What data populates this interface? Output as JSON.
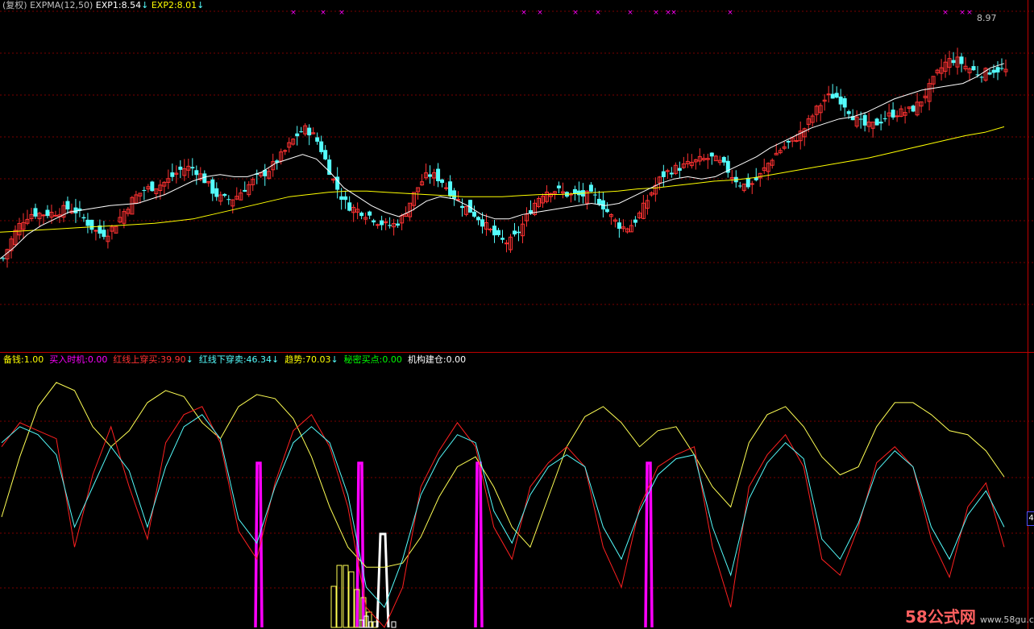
{
  "colors": {
    "up": "#ff3232",
    "down": "#54fcfc",
    "exp1": "#ffffff",
    "exp2": "#ffff00",
    "grid": "#7a0000",
    "cyan": "#54fcfc",
    "yellow": "#ffff54",
    "red": "#ff2020",
    "magenta": "#ff00ff",
    "white": "#ffffff",
    "green": "#00ff00"
  },
  "top_header": [
    {
      "text": "(复权) EXPMA(12,50)",
      "color": "#c0c0c0"
    },
    {
      "text": "EXP1:8.54",
      "color": "#ffffff"
    },
    {
      "text": "↓",
      "color": "#54fcfc"
    },
    {
      "text": "EXP2:8.01",
      "color": "#ffff00"
    },
    {
      "text": "↓",
      "color": "#54fcfc"
    }
  ],
  "high_label": "8.97",
  "bottom_header": [
    {
      "text": "备钱:1.00",
      "color": "#ffff00"
    },
    {
      "text": "买入时机:0.00",
      "color": "#ff00ff"
    },
    {
      "text": "红线上穿买:39.90",
      "color": "#ff3232"
    },
    {
      "text": "↓",
      "color": "#54fcfc"
    },
    {
      "text": "红线下穿卖:46.34",
      "color": "#54fcfc"
    },
    {
      "text": "↓",
      "color": "#54fcfc"
    },
    {
      "text": "趋势:70.03",
      "color": "#ffff00"
    },
    {
      "text": "↓",
      "color": "#54fcfc"
    },
    {
      "text": "秘密买点:0.00",
      "color": "#00ff00"
    },
    {
      "text": "机构建仓:0.00",
      "color": "#ffffff"
    }
  ],
  "right_marker": "4",
  "watermark": {
    "brand": "58公式网",
    "url": "www.58gu.com"
  },
  "chart_data": [
    {
      "type": "candlestick",
      "title": "",
      "series": [
        {
          "name": "EXP1",
          "color": "#ffffff",
          "values": [
            6.82,
            6.92,
            7.04,
            7.12,
            7.18,
            7.24,
            7.26,
            7.28,
            7.3,
            7.31,
            7.32,
            7.36,
            7.4,
            7.46,
            7.52,
            7.56,
            7.58,
            7.56,
            7.56,
            7.6,
            7.68,
            7.72,
            7.76,
            7.72,
            7.6,
            7.46,
            7.38,
            7.3,
            7.24,
            7.2,
            7.26,
            7.34,
            7.38,
            7.36,
            7.3,
            7.22,
            7.18,
            7.18,
            7.22,
            7.24,
            7.26,
            7.28,
            7.3,
            7.32,
            7.3,
            7.32,
            7.38,
            7.44,
            7.5,
            7.54,
            7.56,
            7.54,
            7.56,
            7.62,
            7.68,
            7.74,
            7.82,
            7.88,
            7.94,
            8.0,
            8.04,
            8.08,
            8.1,
            8.14,
            8.2,
            8.26,
            8.3,
            8.34,
            8.36,
            8.38,
            8.4,
            8.46,
            8.54,
            8.58
          ]
        },
        {
          "name": "EXP2",
          "color": "#ffff00",
          "values": [
            7.06,
            7.07,
            7.08,
            7.09,
            7.1,
            7.11,
            7.12,
            7.13,
            7.14,
            7.16,
            7.18,
            7.22,
            7.26,
            7.3,
            7.34,
            7.38,
            7.4,
            7.42,
            7.43,
            7.43,
            7.42,
            7.41,
            7.4,
            7.39,
            7.38,
            7.38,
            7.38,
            7.39,
            7.4,
            7.4,
            7.41,
            7.42,
            7.43,
            7.45,
            7.46,
            7.48,
            7.5,
            7.52,
            7.53,
            7.55,
            7.58,
            7.61,
            7.64,
            7.67,
            7.7,
            7.73,
            7.77,
            7.81,
            7.85,
            7.89,
            7.93,
            7.96,
            8.01
          ]
        }
      ],
      "ohlc_count": 250,
      "high": 8.97
    },
    {
      "type": "line",
      "title": "",
      "series": [
        {
          "name": "趋势",
          "color": "#ffff54",
          "values": [
            25,
            55,
            80,
            92,
            88,
            70,
            60,
            68,
            82,
            88,
            85,
            72,
            64,
            80,
            86,
            84,
            74,
            55,
            30,
            10,
            0,
            0,
            2,
            15,
            35,
            50,
            55,
            40,
            20,
            10,
            35,
            60,
            75,
            80,
            72,
            60,
            68,
            70,
            56,
            40,
            30,
            62,
            76,
            80,
            70,
            55,
            46,
            50,
            70,
            82,
            82,
            76,
            68,
            66,
            58,
            45
          ]
        },
        {
          "name": "红线上穿买",
          "color": "#ff2020",
          "values": [
            60,
            72,
            68,
            64,
            10,
            46,
            70,
            40,
            14,
            62,
            76,
            80,
            62,
            18,
            4,
            42,
            68,
            76,
            60,
            30,
            -20,
            -30,
            -10,
            40,
            58,
            72,
            60,
            20,
            4,
            40,
            52,
            60,
            50,
            10,
            -10,
            30,
            50,
            56,
            60,
            10,
            -20,
            40,
            56,
            66,
            50,
            4,
            -4,
            20,
            52,
            60,
            50,
            14,
            -5,
            30,
            42,
            10
          ]
        },
        {
          "name": "红线下穿卖",
          "color": "#54fcfc",
          "values": [
            62,
            70,
            66,
            56,
            20,
            40,
            60,
            48,
            20,
            50,
            70,
            76,
            64,
            24,
            12,
            40,
            62,
            70,
            62,
            36,
            -10,
            -20,
            4,
            36,
            54,
            66,
            62,
            28,
            12,
            36,
            50,
            56,
            50,
            20,
            4,
            28,
            46,
            54,
            56,
            20,
            -4,
            34,
            52,
            62,
            54,
            14,
            4,
            22,
            48,
            58,
            50,
            20,
            4,
            26,
            38,
            20
          ]
        }
      ],
      "spikes": [
        {
          "name": "买入时机",
          "color": "#ff00ff",
          "count": 5,
          "value": 100
        },
        {
          "name": "备钱",
          "color": "#ffff00",
          "type": "hollow-bars",
          "count": 8
        },
        {
          "name": "机构建仓",
          "color": "#ffffff",
          "type": "hollow-bars",
          "count": 5
        }
      ]
    }
  ]
}
